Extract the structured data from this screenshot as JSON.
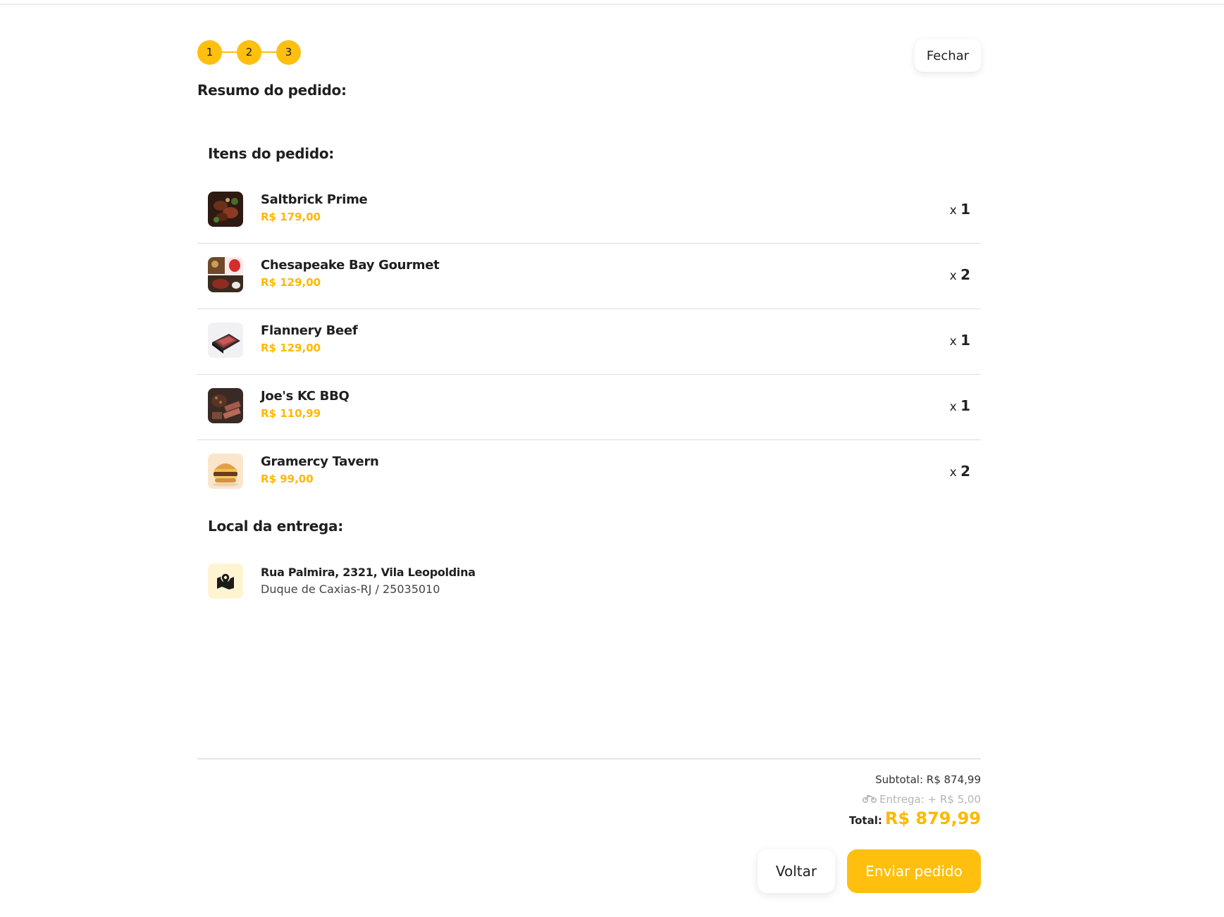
{
  "stepper": {
    "steps": [
      "1",
      "2",
      "3"
    ]
  },
  "header": {
    "title": "Resumo do pedido:",
    "close_label": "Fechar"
  },
  "items_section": {
    "title": "Itens do pedido:",
    "qty_prefix": "x",
    "items": [
      {
        "name": "Saltbrick Prime",
        "price": "R$ 179,00",
        "qty": "1",
        "thumb": "steak-platter"
      },
      {
        "name": "Chesapeake Bay Gourmet",
        "price": "R$ 129,00",
        "qty": "2",
        "thumb": "meat-collage"
      },
      {
        "name": "Flannery Beef",
        "price": "R$ 129,00",
        "qty": "1",
        "thumb": "boxed-steak"
      },
      {
        "name": "Joe's KC BBQ",
        "price": "R$ 110,99",
        "qty": "1",
        "thumb": "bbq-platter"
      },
      {
        "name": "Gramercy Tavern",
        "price": "R$ 99,00",
        "qty": "2",
        "thumb": "burger"
      }
    ]
  },
  "delivery_section": {
    "title": "Local da entrega:",
    "icon": "map-pin-icon",
    "address_line1": "Rua Palmira, 2321, Vila Leopoldina",
    "address_line2": "Duque de Caxias-RJ / 25035010"
  },
  "summary": {
    "subtotal": "Subtotal: R$ 874,99",
    "delivery": "Entrega: + R$ 5,00",
    "delivery_icon": "motorcycle-icon",
    "total_label": "Total:",
    "total_value": "R$ 879,99"
  },
  "actions": {
    "back_label": "Voltar",
    "send_label": "Enviar pedido"
  },
  "colors": {
    "accent": "#ffbf0f",
    "price": "#ffb800",
    "muted": "#b5b5b5"
  }
}
